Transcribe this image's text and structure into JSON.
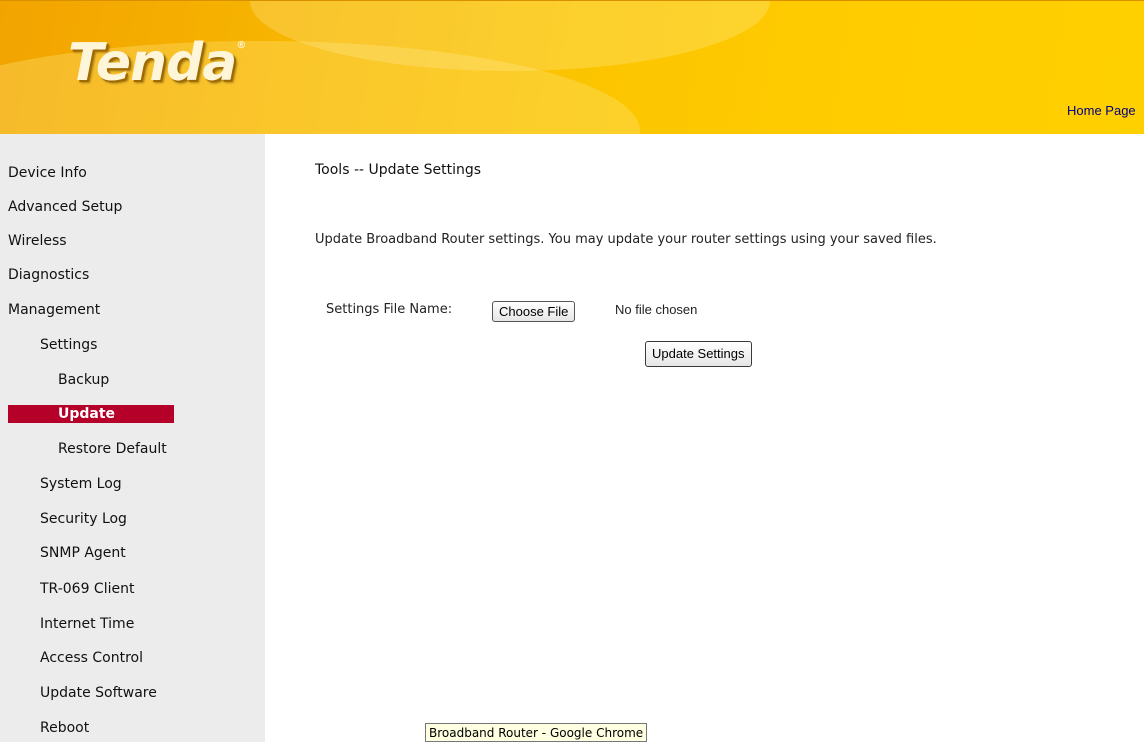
{
  "header": {
    "logo_text": "Tenda",
    "logo_mark": "®",
    "home_link": "Home Page",
    "colors": {
      "gradient_start": "#f2a300",
      "gradient_end": "#ffd000"
    }
  },
  "sidebar": {
    "items": [
      {
        "label": "Device Info"
      },
      {
        "label": "Advanced Setup"
      },
      {
        "label": "Wireless"
      },
      {
        "label": "Diagnostics"
      },
      {
        "label": "Management"
      },
      {
        "label": "Settings"
      },
      {
        "label": "Backup"
      },
      {
        "label": "Update",
        "active": true
      },
      {
        "label": "Restore Default"
      },
      {
        "label": "System Log"
      },
      {
        "label": "Security Log"
      },
      {
        "label": "SNMP Agent"
      },
      {
        "label": "TR-069 Client"
      },
      {
        "label": "Internet Time"
      },
      {
        "label": "Access Control"
      },
      {
        "label": "Update Software"
      },
      {
        "label": "Reboot"
      }
    ],
    "active_color": "#b5002a"
  },
  "main": {
    "title": "Tools -- Update Settings",
    "description": "Update Broadband Router settings. You may update your router settings using your saved files.",
    "file_label": "Settings File Name:",
    "choose_file_label": "Choose File",
    "no_file_text": "No file chosen",
    "update_button_label": "Update Settings"
  },
  "tooltip": {
    "text": "Broadband Router - Google Chrome"
  }
}
